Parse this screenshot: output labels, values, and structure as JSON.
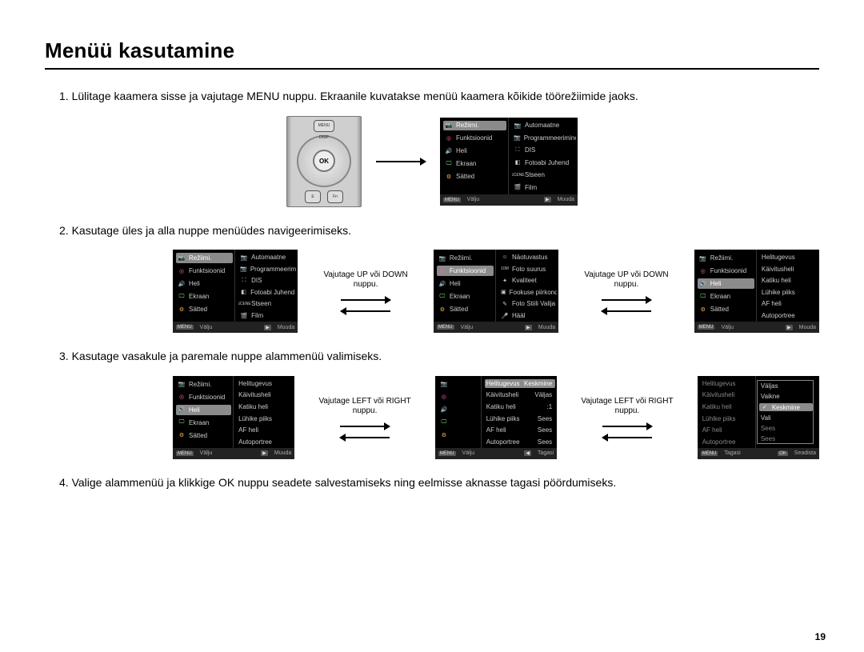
{
  "page_number": "19",
  "title": "Menüü kasutamine",
  "steps": {
    "s1": "1. Lülitage kaamera sisse ja vajutage MENU nuppu. Ekraanile kuvatakse menüü kaamera kõikide töörežiimide jaoks.",
    "s2": "2. Kasutage üles ja alla nuppe menüüdes navigeerimiseks.",
    "s3": "3. Kasutage vasakule ja paremale nuppe alammenüü valimiseks.",
    "s4": "4. Valige alammenüü ja klikkige OK nuppu seadete salvestamiseks ning eelmisse aknasse tagasi pöördumiseks."
  },
  "arrows": {
    "updown": "Vajutage UP või DOWN nuppu.",
    "leftright": "Vajutage LEFT või RIGHT nuppu."
  },
  "campad": {
    "menu": "MENU",
    "disp": "DISP",
    "ok": "OK",
    "e": "E",
    "fn": "Fn"
  },
  "menu": {
    "left_main": [
      "Režiimi.",
      "Funktsioonid",
      "Heli",
      "Ekraan",
      "Sätted"
    ],
    "right_modes": [
      "Automaatne",
      "Programmeerimine",
      "DIS",
      "Fotoabi Juhend",
      "Stseen",
      "Film"
    ],
    "right_func": [
      "Näotuvastus",
      "Foto suurus",
      "Kvaliteet",
      "Fookuse piirkond",
      "Foto Stiili Valija",
      "Hääl"
    ],
    "right_heli": [
      "Helitugevus",
      "Käivitusheli",
      "Katiku heli",
      "Lühike piiks",
      "AF heli",
      "Autoportree"
    ],
    "right_heli_vals": [
      "Keskmine",
      "Väljas",
      ":1",
      "Sees",
      "Sees",
      "Sees"
    ],
    "right_opts": [
      "Väljas",
      "Vaikne",
      "Keskmine",
      "Vali"
    ],
    "right_opts_dim": [
      "Sees",
      "Sees"
    ],
    "footer": {
      "menu": "MENU",
      "play": "▶",
      "valju": "Välju",
      "muuda": "Muuda",
      "tagasi": "Tagasi",
      "seadista": "Seadista",
      "ok": "OK"
    }
  },
  "icons": {
    "cam": "📷",
    "fx": "◎",
    "snd": "🔊",
    "scr": "🖵",
    "set": "⚙",
    "auto": "A",
    "prog": "P",
    "dis": "⛶",
    "guide": "◧",
    "scene": "SCENE",
    "film": "🎬",
    "face": "☺",
    "size": "10M",
    "qual": "✦",
    "focus": "▣",
    "style": "✎",
    "voice": "🎤",
    "check": "✓"
  }
}
